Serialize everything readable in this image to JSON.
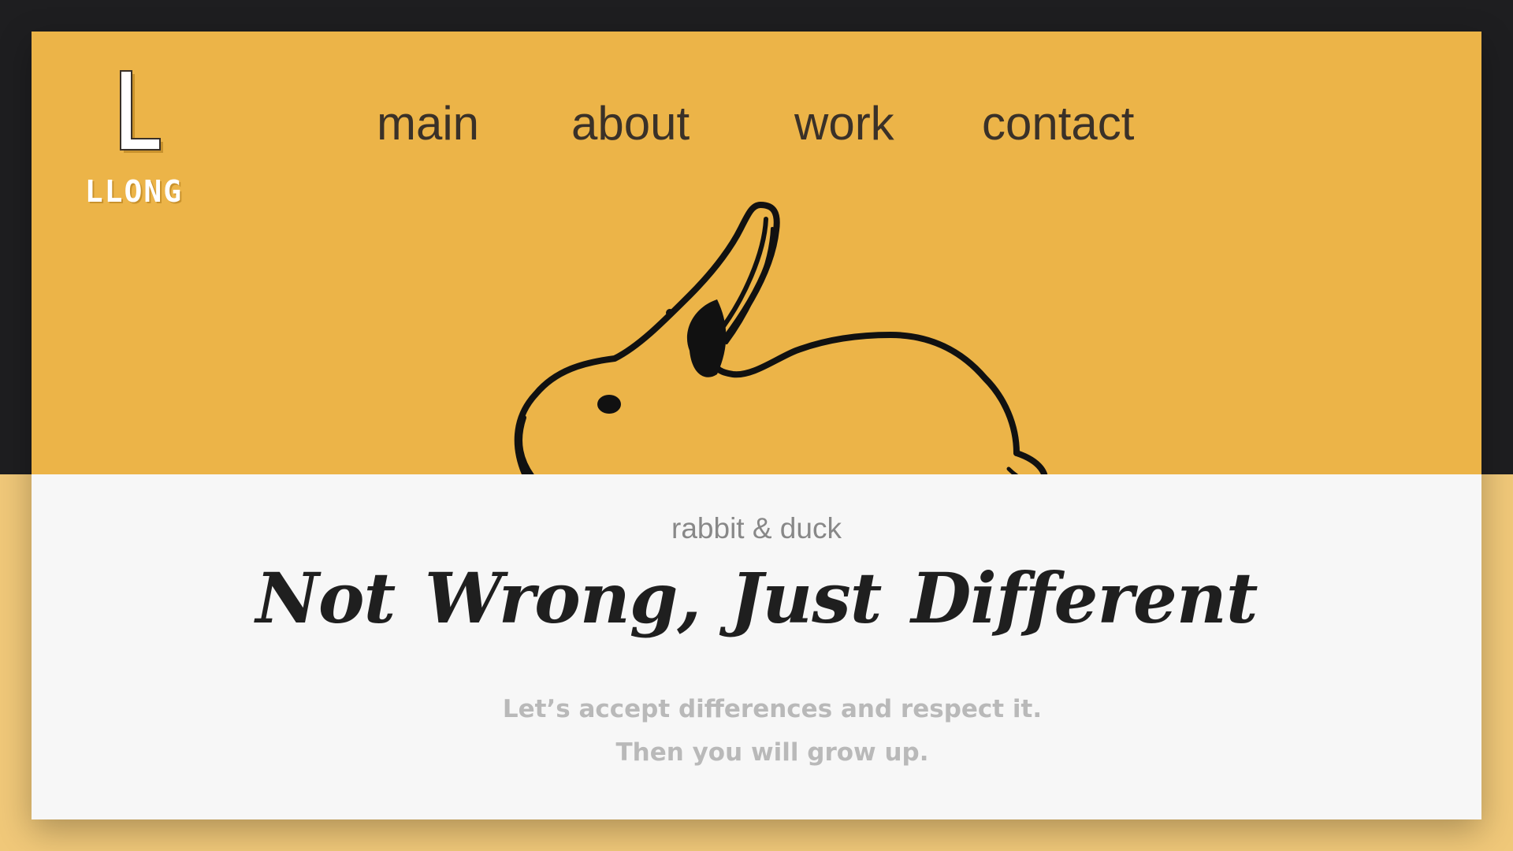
{
  "logo": {
    "mark": "L",
    "text": "LLONG"
  },
  "nav": {
    "main": "main",
    "about": "about",
    "work": "work",
    "contact": "contact"
  },
  "hero": {
    "illustration": "rabbit-duck-illusion-drawing"
  },
  "content": {
    "eyebrow": "rabbit & duck",
    "headline": "Not Wrong,  Just Different",
    "sub1": "Let’s accept differences and respect it.",
    "sub2": "Then you will grow up."
  },
  "colors": {
    "background_dark": "#1e1e20",
    "background_gold_light": "#f0c879",
    "hero_gold": "#ecb448",
    "card": "#f7f7f7",
    "ink": "#1f1f1f"
  }
}
